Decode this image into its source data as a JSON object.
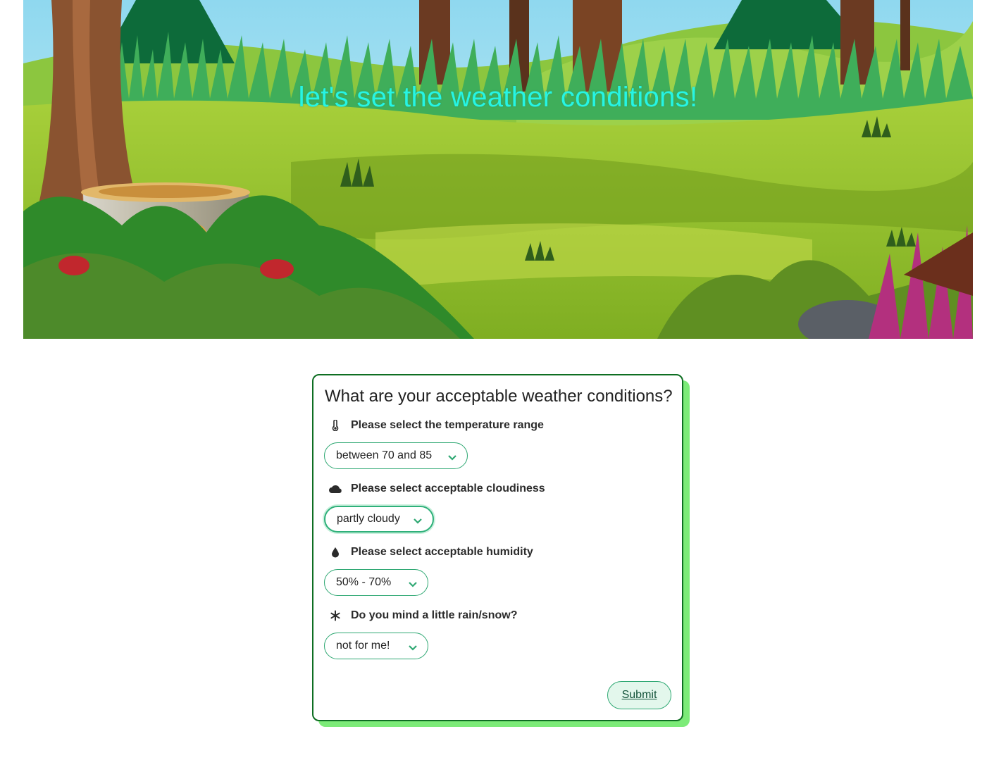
{
  "hero": {
    "title": "let's set the weather conditions!"
  },
  "form": {
    "heading": "What are your acceptable weather conditions?",
    "fields": [
      {
        "label": "Please select the temperature range",
        "icon": "thermometer-icon",
        "value": "between 70 and 85"
      },
      {
        "label": "Please select acceptable cloudiness",
        "icon": "cloud-icon",
        "value": "partly cloudy"
      },
      {
        "label": "Please select acceptable humidity",
        "icon": "droplet-icon",
        "value": "50% - 70%"
      },
      {
        "label": "Do you mind a little rain/snow?",
        "icon": "snowflake-icon",
        "value": "not for me!"
      }
    ],
    "submit_label": "Submit"
  },
  "colors": {
    "accent": "#2fa873",
    "card_border": "#0e6e22",
    "card_shadow": "#7ceb78",
    "hero_title": "#26f5e3"
  }
}
